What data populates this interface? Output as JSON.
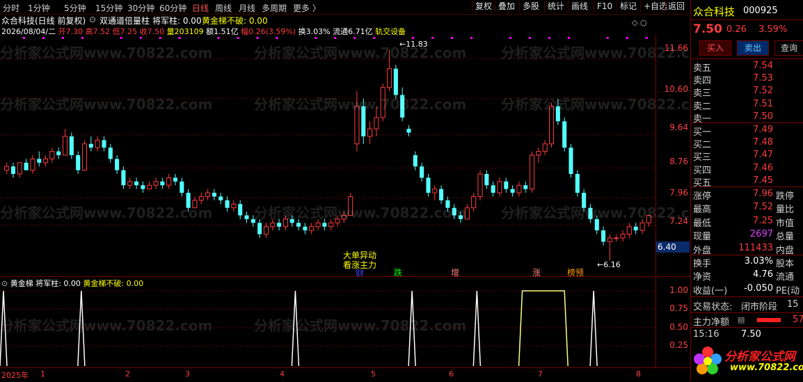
{
  "toolbar": {
    "periods": [
      "分时",
      "1分钟",
      "5分钟",
      "15分钟",
      "30分钟",
      "60分钟",
      "日线",
      "周线",
      "月线",
      "多周期",
      "更多 〉"
    ],
    "active_period": "日线",
    "buttons": [
      "复权",
      "叠加",
      "多股",
      "统计",
      "画线",
      "F10",
      "标记",
      "+自选",
      "返回"
    ]
  },
  "header": {
    "title": "众合科技(日线 前复权)",
    "indicator": "双通道倍量柱",
    "indicator_values": "将军柱: 0.00",
    "indicator_values2": "黄金梯不破: 0.00"
  },
  "info_line": {
    "date": "2026/08/04/二",
    "open_label": "开",
    "open": "7.30",
    "high_label": "高",
    "high": "7.52",
    "low_label": "低",
    "low": "7.25",
    "close_label": "收",
    "close": "7.50",
    "vol_label": "量",
    "vol": "203109",
    "amt_label": "额",
    "amt": "1.51亿",
    "chg_label": "幅",
    "chg": "0.26(3.59%)",
    "turn_label": "换",
    "turn": "3.03%",
    "float_label": "流通",
    "float": "6.71亿",
    "sector": "轨交设备"
  },
  "main_axis": [
    "11.66",
    "10.60",
    "9.64",
    "8.76",
    "7.96",
    "7.24",
    "6.40"
  ],
  "annotations": {
    "high_mark": "11.83",
    "low_mark": "6.16",
    "event1_line1": "大单异动",
    "event1_line2": "看涨主力",
    "tag_cai": "财",
    "tag_die": "跌",
    "tag_zeng": "增",
    "tag_zhang": "涨",
    "tag_bang": "榜",
    "tag_yu": "预"
  },
  "sub_chart": {
    "title": "黄金梯",
    "v1": "将军柱: 0.00",
    "v2": "黄金梯不破: 0.00",
    "axis": [
      "1.00",
      "0.75",
      "0.50",
      "0.25"
    ]
  },
  "x_axis": [
    "2025年",
    "1",
    "2",
    "3",
    "4",
    "5",
    "6",
    "7",
    "8"
  ],
  "watermark": "分析家公式网www.70822.com",
  "logo": {
    "text": "分析家公式网",
    "url": "www.70822.com"
  },
  "quote": {
    "name": "众合科技",
    "code": "000925",
    "price": "7.50",
    "change": "0.26",
    "pct": "3.59%",
    "buy_btn": "买入",
    "sell_btn": "卖出",
    "query_btn": "查询",
    "asks": [
      {
        "label": "卖五",
        "price": "7.54"
      },
      {
        "label": "卖四",
        "price": "7.53"
      },
      {
        "label": "卖三",
        "price": "7.52"
      },
      {
        "label": "卖二",
        "price": "7.51"
      },
      {
        "label": "卖一",
        "price": "7.50"
      }
    ],
    "bids": [
      {
        "label": "买一",
        "price": "7.49"
      },
      {
        "label": "买二",
        "price": "7.48"
      },
      {
        "label": "买三",
        "price": "7.47"
      },
      {
        "label": "买四",
        "price": "7.46"
      },
      {
        "label": "买五",
        "price": "7.45"
      }
    ],
    "stats": [
      {
        "l": "涨停",
        "v": "7.96",
        "r": "跌停",
        "c": "red"
      },
      {
        "l": "最高",
        "v": "7.52",
        "r": "量比",
        "c": "red"
      },
      {
        "l": "最低",
        "v": "7.25",
        "r": "市值",
        "c": "red"
      },
      {
        "l": "现量",
        "v": "2697",
        "r": "总量",
        "c": "magenta"
      },
      {
        "l": "外盘",
        "v": "111433",
        "r": "内盘",
        "c": "red"
      }
    ],
    "stats2": [
      {
        "l": "换手",
        "v": "3.03%",
        "r": "股本"
      },
      {
        "l": "净资",
        "v": "4.76",
        "r": "流通"
      },
      {
        "l": "收益(一)",
        "v": "-0.050",
        "r": "PE(动"
      }
    ],
    "trade_status_label": "交易状态:",
    "trade_status": "闭市阶段",
    "trade_status_extra": "15",
    "main_flow_label": "主力净额",
    "main_flow_val": "57",
    "last_time": "15:16",
    "last_price": "7.50"
  },
  "chart_data": {
    "type": "candlestick",
    "ylim": [
      5.9,
      12.3
    ],
    "candles": [
      [
        8.7,
        8.9,
        8.6,
        8.8
      ],
      [
        8.8,
        8.9,
        8.5,
        8.6
      ],
      [
        8.6,
        8.9,
        8.5,
        8.9
      ],
      [
        8.9,
        9.0,
        8.7,
        8.7
      ],
      [
        8.7,
        9.1,
        8.6,
        9.0
      ],
      [
        9.0,
        9.2,
        8.8,
        8.9
      ],
      [
        8.9,
        9.1,
        8.8,
        9.0
      ],
      [
        9.0,
        9.3,
        8.9,
        9.2
      ],
      [
        9.2,
        9.3,
        9.0,
        9.1
      ],
      [
        9.1,
        9.8,
        9.1,
        9.6
      ],
      [
        9.6,
        9.7,
        9.0,
        9.1
      ],
      [
        9.1,
        9.2,
        8.6,
        8.7
      ],
      [
        8.7,
        9.5,
        8.7,
        9.4
      ],
      [
        9.4,
        9.6,
        9.2,
        9.3
      ],
      [
        9.3,
        9.6,
        9.2,
        9.5
      ],
      [
        9.5,
        9.6,
        9.2,
        9.3
      ],
      [
        9.3,
        9.4,
        8.9,
        9.0
      ],
      [
        9.0,
        9.1,
        8.6,
        8.7
      ],
      [
        8.7,
        8.8,
        8.2,
        8.3
      ],
      [
        8.3,
        8.5,
        8.2,
        8.4
      ],
      [
        8.4,
        8.5,
        8.2,
        8.3
      ],
      [
        8.3,
        8.4,
        8.1,
        8.2
      ],
      [
        8.2,
        8.4,
        8.2,
        8.3
      ],
      [
        8.3,
        8.5,
        8.2,
        8.4
      ],
      [
        8.4,
        8.5,
        8.2,
        8.3
      ],
      [
        8.3,
        8.6,
        8.2,
        8.5
      ],
      [
        8.5,
        8.6,
        8.3,
        8.4
      ],
      [
        8.4,
        8.5,
        8.0,
        8.1
      ],
      [
        8.1,
        8.2,
        7.6,
        7.7
      ],
      [
        7.7,
        8.0,
        7.7,
        7.9
      ],
      [
        7.9,
        8.1,
        7.8,
        8.0
      ],
      [
        8.0,
        8.2,
        7.9,
        8.1
      ],
      [
        8.1,
        8.2,
        7.9,
        8.0
      ],
      [
        8.0,
        8.1,
        7.8,
        7.9
      ],
      [
        7.9,
        8.0,
        7.6,
        7.7
      ],
      [
        7.7,
        7.9,
        7.6,
        7.8
      ],
      [
        7.8,
        7.9,
        7.4,
        7.5
      ],
      [
        7.5,
        7.6,
        7.3,
        7.4
      ],
      [
        7.4,
        7.5,
        7.2,
        7.3
      ],
      [
        7.3,
        7.4,
        6.9,
        7.0
      ],
      [
        7.0,
        7.3,
        6.9,
        7.2
      ],
      [
        7.2,
        7.4,
        7.1,
        7.3
      ],
      [
        7.3,
        7.4,
        7.1,
        7.2
      ],
      [
        7.2,
        7.5,
        7.1,
        7.4
      ],
      [
        7.4,
        7.5,
        7.2,
        7.3
      ],
      [
        7.3,
        7.4,
        7.1,
        7.2
      ],
      [
        7.2,
        7.3,
        7.0,
        7.1
      ],
      [
        7.1,
        7.3,
        7.0,
        7.2
      ],
      [
        7.2,
        7.4,
        7.1,
        7.3
      ],
      [
        7.3,
        7.4,
        7.1,
        7.2
      ],
      [
        7.2,
        7.4,
        7.1,
        7.3
      ],
      [
        7.3,
        7.5,
        7.2,
        7.4
      ],
      [
        7.4,
        7.6,
        7.3,
        7.5
      ],
      [
        7.5,
        8.1,
        7.5,
        8.0
      ],
      [
        9.4,
        10.8,
        9.2,
        10.4
      ],
      [
        10.4,
        10.6,
        9.4,
        9.6
      ],
      [
        9.6,
        10.0,
        9.4,
        9.8
      ],
      [
        9.8,
        10.4,
        9.6,
        10.1
      ],
      [
        10.1,
        11.0,
        10.0,
        10.9
      ],
      [
        10.9,
        11.9,
        10.8,
        11.4
      ],
      [
        11.4,
        11.5,
        10.6,
        10.7
      ],
      [
        10.7,
        10.9,
        10.0,
        10.1
      ],
      [
        9.8,
        9.9,
        9.6,
        9.7
      ],
      [
        9.1,
        9.2,
        8.7,
        8.8
      ],
      [
        8.8,
        8.9,
        8.4,
        8.5
      ],
      [
        8.5,
        8.6,
        8.0,
        8.1
      ],
      [
        8.1,
        8.3,
        7.9,
        8.2
      ],
      [
        8.2,
        8.3,
        7.8,
        7.9
      ],
      [
        7.9,
        8.0,
        7.6,
        7.7
      ],
      [
        7.7,
        7.8,
        7.4,
        7.5
      ],
      [
        7.5,
        7.6,
        7.3,
        7.4
      ],
      [
        7.4,
        7.8,
        7.4,
        7.7
      ],
      [
        7.7,
        8.1,
        7.6,
        8.0
      ],
      [
        8.0,
        8.7,
        7.9,
        8.6
      ],
      [
        8.6,
        8.7,
        8.2,
        8.3
      ],
      [
        8.3,
        8.4,
        8.0,
        8.1
      ],
      [
        8.1,
        8.5,
        8.0,
        8.4
      ],
      [
        8.4,
        8.5,
        8.1,
        8.2
      ],
      [
        8.2,
        8.3,
        8.0,
        8.1
      ],
      [
        8.1,
        8.4,
        8.0,
        8.3
      ],
      [
        8.3,
        8.4,
        8.1,
        8.2
      ],
      [
        8.2,
        9.2,
        8.1,
        9.1
      ],
      [
        9.1,
        9.3,
        8.9,
        9.2
      ],
      [
        9.2,
        9.5,
        9.1,
        9.4
      ],
      [
        9.4,
        10.5,
        9.3,
        10.4
      ],
      [
        10.4,
        10.6,
        9.9,
        10.0
      ],
      [
        10.0,
        10.1,
        9.2,
        9.3
      ],
      [
        9.3,
        9.4,
        8.5,
        8.6
      ],
      [
        8.6,
        8.7,
        8.0,
        8.1
      ],
      [
        8.1,
        8.2,
        7.6,
        7.7
      ],
      [
        7.7,
        7.8,
        7.3,
        7.4
      ],
      [
        7.4,
        7.5,
        7.0,
        7.1
      ],
      [
        7.1,
        7.2,
        6.7,
        6.8
      ],
      [
        6.8,
        7.0,
        6.3,
        6.9
      ],
      [
        6.9,
        7.0,
        6.8,
        6.9
      ],
      [
        6.9,
        7.1,
        6.8,
        7.0
      ],
      [
        7.0,
        7.3,
        6.9,
        7.2
      ],
      [
        7.2,
        7.3,
        7.0,
        7.1
      ],
      [
        7.1,
        7.4,
        7.0,
        7.3
      ],
      [
        7.3,
        7.5,
        7.2,
        7.5
      ]
    ],
    "signal_pulses": [
      0.0,
      0.12,
      0.45,
      0.63,
      0.73,
      0.91
    ],
    "signal_plateau": [
      0.8,
      0.865
    ]
  }
}
